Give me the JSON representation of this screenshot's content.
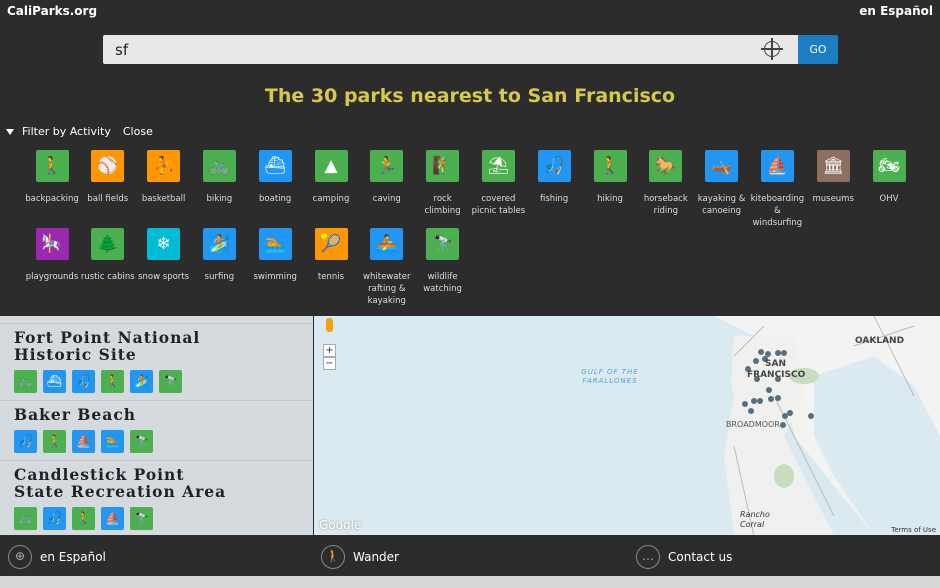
{
  "header": {
    "logo": "CaliParks.org",
    "language_link": "en Español"
  },
  "search": {
    "value": "sf",
    "go_label": "GO"
  },
  "results_title": "The 30 parks nearest to San Francisco",
  "filter": {
    "label": "Filter by Activity",
    "close_label": "Close"
  },
  "activities": [
    {
      "label": "backpacking",
      "icon": "🚶",
      "color": "#4caf50"
    },
    {
      "label": "ball fields",
      "icon": "⚾",
      "color": "#ff9800"
    },
    {
      "label": "basketball",
      "icon": "⛹",
      "color": "#ff9800"
    },
    {
      "label": "biking",
      "icon": "🚲",
      "color": "#4caf50"
    },
    {
      "label": "boating",
      "icon": "⛴",
      "color": "#2196f3"
    },
    {
      "label": "camping",
      "icon": "▲",
      "color": "#4caf50"
    },
    {
      "label": "caving",
      "icon": "🏃",
      "color": "#4caf50"
    },
    {
      "label": "rock climbing",
      "icon": "🧗",
      "color": "#4caf50"
    },
    {
      "label": "covered picnic tables",
      "icon": "⛱",
      "color": "#4caf50"
    },
    {
      "label": "fishing",
      "icon": "🎣",
      "color": "#2196f3"
    },
    {
      "label": "hiking",
      "icon": "🚶",
      "color": "#4caf50"
    },
    {
      "label": "horseback riding",
      "icon": "🐎",
      "color": "#4caf50"
    },
    {
      "label": "kayaking & canoeing",
      "icon": "🛶",
      "color": "#2196f3"
    },
    {
      "label": "kiteboarding & windsurfing",
      "icon": "⛵",
      "color": "#2196f3"
    },
    {
      "label": "museums",
      "icon": "🏛",
      "color": "#8d6e63"
    },
    {
      "label": "OHV",
      "icon": "🏍",
      "color": "#4caf50"
    },
    {
      "label": "playgrounds",
      "icon": "🎠",
      "color": "#9c27b0"
    },
    {
      "label": "rustic cabins",
      "icon": "🌲",
      "color": "#4caf50"
    },
    {
      "label": "snow sports",
      "icon": "❄",
      "color": "#00bcd4"
    },
    {
      "label": "surfing",
      "icon": "🏄",
      "color": "#2196f3"
    },
    {
      "label": "swimming",
      "icon": "🏊",
      "color": "#2196f3"
    },
    {
      "label": "tennis",
      "icon": "🎾",
      "color": "#ff9800"
    },
    {
      "label": "whitewater rafting & kayaking",
      "icon": "🚣",
      "color": "#2196f3"
    },
    {
      "label": "wildlife watching",
      "icon": "🔭",
      "color": "#4caf50"
    }
  ],
  "parks": [
    {
      "name": "Fort Point National Historic Site",
      "icons": [
        [
          "🚲",
          "#4caf50"
        ],
        [
          "⛴",
          "#2196f3"
        ],
        [
          "🎣",
          "#2196f3"
        ],
        [
          "🚶",
          "#4caf50"
        ],
        [
          "🏄",
          "#2196f3"
        ],
        [
          "🔭",
          "#4caf50"
        ]
      ]
    },
    {
      "name": "Baker Beach",
      "icons": [
        [
          "🎣",
          "#2196f3"
        ],
        [
          "🚶",
          "#4caf50"
        ],
        [
          "⛵",
          "#2196f3"
        ],
        [
          "🏊",
          "#2196f3"
        ],
        [
          "🔭",
          "#4caf50"
        ]
      ]
    },
    {
      "name": "Candlestick Point State Recreation Area",
      "icons": [
        [
          "🚲",
          "#4caf50"
        ],
        [
          "🎣",
          "#2196f3"
        ],
        [
          "🚶",
          "#4caf50"
        ],
        [
          "⛵",
          "#2196f3"
        ],
        [
          "🔭",
          "#4caf50"
        ]
      ]
    }
  ],
  "map": {
    "labels": {
      "oakland": "OAKLAND",
      "sf1": "SAN",
      "sf2": "FRANCISCO",
      "gulf": "GULF OF THE FARALLONES",
      "broadmoor": "BROADMOOR",
      "rancho": "Rancho Corral",
      "terms": "Terms of Use",
      "google": "Google"
    },
    "zoom_in": "+",
    "zoom_out": "−"
  },
  "footer": {
    "spanish": "en Español",
    "wander": "Wander",
    "contact": "Contact us"
  }
}
